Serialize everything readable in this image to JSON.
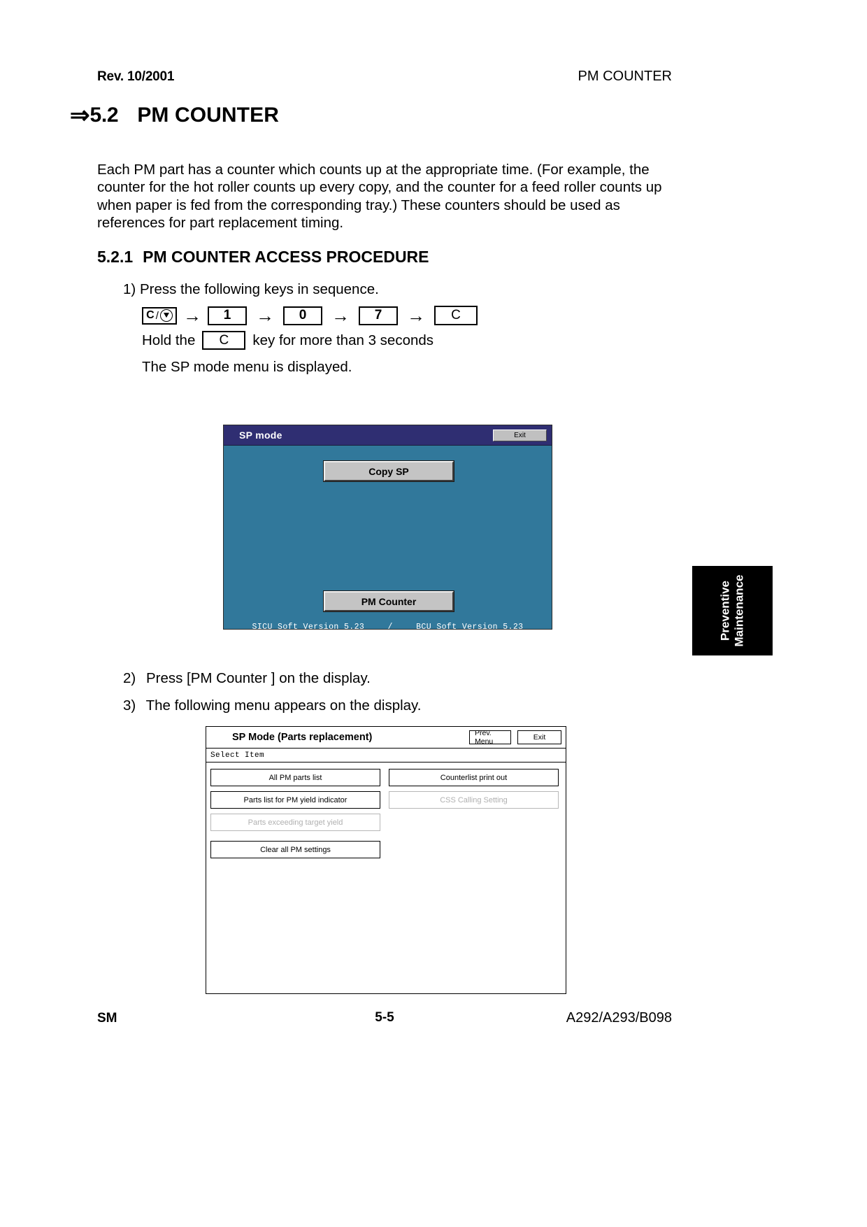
{
  "header": {
    "revision": "Rev. 10/2001",
    "running_title": "PM COUNTER"
  },
  "section": {
    "arrow": "⇒",
    "number": "5.2",
    "title": "PM COUNTER",
    "intro": "Each PM part has a counter which counts up at the appropriate time. (For example, the counter for the hot roller counts up every copy, and the counter for a feed roller counts up when paper is fed from the corresponding tray.) These counters should be used as references for part replacement timing."
  },
  "subsection": {
    "number": "5.2.1",
    "title": "PM COUNTER ACCESS PROCEDURE"
  },
  "steps": {
    "step1_number": "1)",
    "step1_text": "Press the following keys in sequence.",
    "step2_number": "2)",
    "step2_text": "Press [PM Counter ] on the display.",
    "step3_number": "3)",
    "step3_text": "The following menu appears on the display."
  },
  "key_sequence": {
    "key1_letter": "C",
    "key1_slash": "/",
    "key1_icon": "stop-circle-icon",
    "key2": "1",
    "key3": "0",
    "key4": "7",
    "key5": "C",
    "arrow": "→"
  },
  "hold_line": {
    "before": "Hold the",
    "key": "C",
    "after": "key for more than 3 seconds"
  },
  "sp_mode_displayed": "The SP mode menu is displayed.",
  "sp_panel": {
    "title": "SP mode",
    "exit_label": "Exit",
    "copy_sp_label": "Copy SP",
    "pm_counter_label": "PM Counter",
    "version_left": "SICU Soft Version 5.23",
    "version_sep": "/",
    "version_right": "BCU Soft Version 5.23",
    "titlebar_color": "#2f2e72",
    "body_color": "#31789b"
  },
  "parts_panel": {
    "title": "SP Mode (Parts replacement)",
    "prev_menu_label": "Prev. Menu",
    "exit_label": "Exit",
    "select_item_label": "Select  Item",
    "buttons": [
      {
        "label": "All PM parts list",
        "enabled": true
      },
      {
        "label": "Counterlist print out",
        "enabled": true
      },
      {
        "label": "Parts list for PM yield indicator",
        "enabled": true
      },
      {
        "label": "CSS Calling Setting",
        "enabled": false
      },
      {
        "label": "Parts exceeding target yield",
        "enabled": false
      },
      {
        "label": "Clear all PM settings",
        "enabled": true
      }
    ]
  },
  "side_tab": {
    "line1": "Preventive",
    "line2": "Maintenance"
  },
  "footer": {
    "left": "SM",
    "page": "5-5",
    "right": "A292/A293/B098"
  }
}
